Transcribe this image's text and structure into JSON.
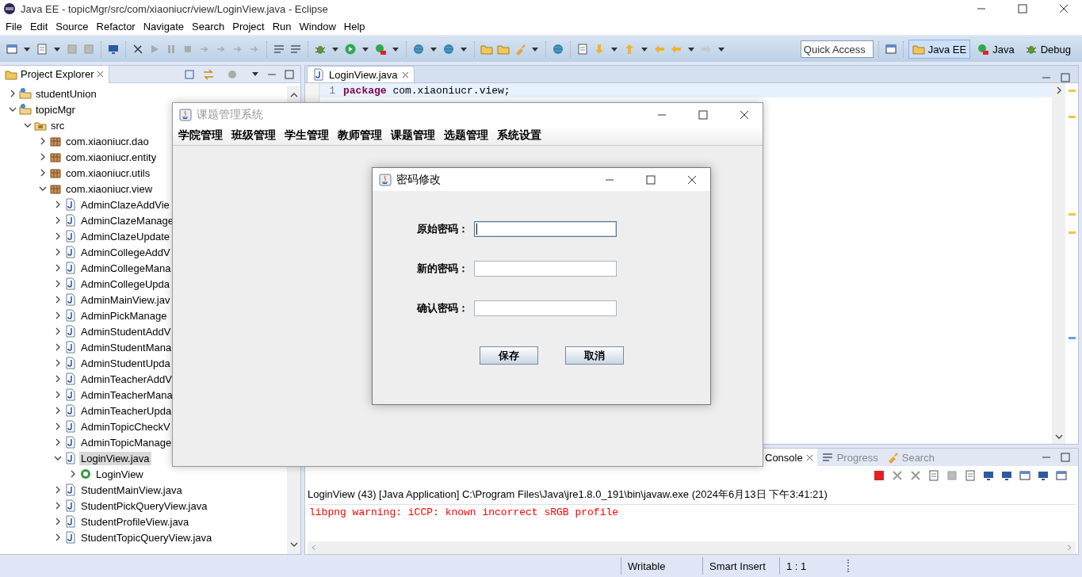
{
  "window": {
    "title": "Java EE - topicMgr/src/com/xiaoniucr/view/LoginView.java - Eclipse"
  },
  "menu": [
    "File",
    "Edit",
    "Source",
    "Refactor",
    "Navigate",
    "Search",
    "Project",
    "Run",
    "Window",
    "Help"
  ],
  "toolbar": {
    "quick_access": {
      "placeholder": "Quick Access"
    },
    "perspectives": [
      {
        "label": "Java EE",
        "selected": true
      },
      {
        "label": "Java",
        "selected": false
      },
      {
        "label": "Debug",
        "selected": false
      }
    ]
  },
  "project_explorer": {
    "title": "Project Explorer",
    "tree": [
      {
        "label": "studentUnion",
        "kind": "project",
        "expanded": false,
        "selected": false
      },
      {
        "label": "topicMgr",
        "kind": "project",
        "expanded": true,
        "selected": false,
        "children": [
          {
            "label": "src",
            "kind": "source",
            "expanded": true,
            "selected": false,
            "children": [
              {
                "label": "com.xiaoniucr.dao",
                "kind": "package",
                "expanded": false,
                "selected": false
              },
              {
                "label": "com.xiaoniucr.entity",
                "kind": "package",
                "expanded": false,
                "selected": false
              },
              {
                "label": "com.xiaoniucr.utils",
                "kind": "package",
                "expanded": false,
                "selected": false
              },
              {
                "label": "com.xiaoniucr.view",
                "kind": "package",
                "expanded": true,
                "selected": false,
                "children": [
                  {
                    "label": "AdminClazeAddVie",
                    "kind": "file",
                    "expanded": false,
                    "selected": false
                  },
                  {
                    "label": "AdminClazeManage",
                    "kind": "file",
                    "expanded": false,
                    "selected": false
                  },
                  {
                    "label": "AdminClazeUpdate",
                    "kind": "file",
                    "expanded": false,
                    "selected": false
                  },
                  {
                    "label": "AdminCollegeAddV",
                    "kind": "file",
                    "expanded": false,
                    "selected": false
                  },
                  {
                    "label": "AdminCollegeMana",
                    "kind": "file",
                    "expanded": false,
                    "selected": false
                  },
                  {
                    "label": "AdminCollegeUpda",
                    "kind": "file",
                    "expanded": false,
                    "selected": false
                  },
                  {
                    "label": "AdminMainView.jav",
                    "kind": "file",
                    "expanded": false,
                    "selected": false
                  },
                  {
                    "label": "AdminPickManage",
                    "kind": "file",
                    "expanded": false,
                    "selected": false
                  },
                  {
                    "label": "AdminStudentAddV",
                    "kind": "file",
                    "expanded": false,
                    "selected": false
                  },
                  {
                    "label": "AdminStudentMana",
                    "kind": "file",
                    "expanded": false,
                    "selected": false
                  },
                  {
                    "label": "AdminStudentUpda",
                    "kind": "file",
                    "expanded": false,
                    "selected": false
                  },
                  {
                    "label": "AdminTeacherAddV",
                    "kind": "file",
                    "expanded": false,
                    "selected": false
                  },
                  {
                    "label": "AdminTeacherMana",
                    "kind": "file",
                    "expanded": false,
                    "selected": false
                  },
                  {
                    "label": "AdminTeacherUpda",
                    "kind": "file",
                    "expanded": false,
                    "selected": false
                  },
                  {
                    "label": "AdminTopicCheckV",
                    "kind": "file",
                    "expanded": false,
                    "selected": false
                  },
                  {
                    "label": "AdminTopicManage",
                    "kind": "file",
                    "expanded": false,
                    "selected": false
                  },
                  {
                    "label": "LoginView.java",
                    "kind": "file",
                    "expanded": true,
                    "selected": true,
                    "children": [
                      {
                        "label": "LoginView",
                        "kind": "class",
                        "expanded": false,
                        "selected": false
                      }
                    ]
                  },
                  {
                    "label": "StudentMainView.java",
                    "kind": "file",
                    "expanded": false,
                    "selected": false
                  },
                  {
                    "label": "StudentPickQueryView.java",
                    "kind": "file",
                    "expanded": false,
                    "selected": false
                  },
                  {
                    "label": "StudentProfileView.java",
                    "kind": "file",
                    "expanded": false,
                    "selected": false
                  },
                  {
                    "label": "StudentTopicQueryView.java",
                    "kind": "file",
                    "expanded": false,
                    "selected": false
                  }
                ]
              }
            ]
          }
        ]
      }
    ]
  },
  "editor": {
    "tab": {
      "label": "LoginView.java"
    },
    "lines": [
      {
        "number": "1",
        "tokens": [
          {
            "kind": "keyword",
            "text": "package"
          },
          {
            "kind": "plain",
            "text": " com.xiaoniucr.view;"
          }
        ]
      }
    ]
  },
  "console": {
    "tabs": [
      {
        "label": "Console",
        "selected": true
      },
      {
        "label": "Progress",
        "selected": false
      },
      {
        "label": "Search",
        "selected": false
      }
    ],
    "header": "LoginView (43) [Java Application] C:\\Program Files\\Java\\jre1.8.0_191\\bin\\javaw.exe (2024年6月13日 下午3:41:21)",
    "lines": [
      {
        "kind": "error",
        "text": "libpng warning: iCCP: known incorrect sRGB profile"
      }
    ]
  },
  "status_bar": [
    "Writable",
    "Smart Insert",
    "1 : 1"
  ],
  "app_window": {
    "title": "课题管理系统",
    "menu": [
      "学院管理",
      "班级管理",
      "学生管理",
      "教师管理",
      "课题管理",
      "选题管理",
      "系统设置"
    ]
  },
  "dialog": {
    "title": "密码修改",
    "fields": [
      {
        "label": "原始密码：",
        "focused": true
      },
      {
        "label": "新的密码：",
        "focused": false
      },
      {
        "label": "确认密码：",
        "focused": false
      }
    ],
    "buttons": [
      "保存",
      "取消"
    ]
  }
}
